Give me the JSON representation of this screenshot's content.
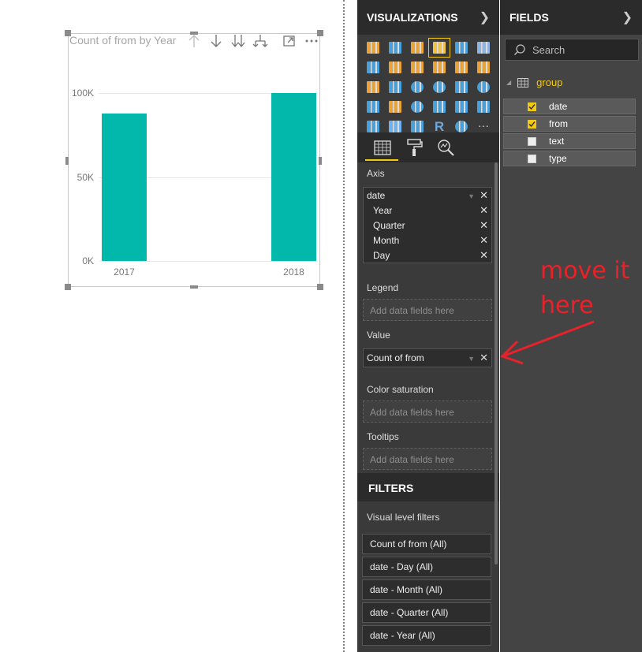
{
  "visual": {
    "title": "Count of from by Year",
    "icons": [
      "drill-up-icon",
      "drill-down-icon",
      "expand-all-icon",
      "expand-next-icon",
      "focus-mode-icon",
      "more-options-icon"
    ]
  },
  "chart_data": {
    "type": "bar",
    "title": "Count of from by Year",
    "categories": [
      "2017",
      "2018"
    ],
    "values": [
      88000,
      101000
    ],
    "yticks": [
      "100K",
      "50K",
      "0K"
    ],
    "ylim": [
      0,
      100000
    ],
    "xlabel": "",
    "ylabel": "",
    "grid": true,
    "color": "#01b8aa"
  },
  "visualizations": {
    "header": "VISUALIZATIONS",
    "tabs": [
      "fields-tab",
      "format-tab",
      "analytics-tab"
    ],
    "wells": {
      "axis": {
        "title": "Axis",
        "field": "date",
        "hierarchy": [
          "Year",
          "Quarter",
          "Month",
          "Day"
        ]
      },
      "legend": {
        "title": "Legend",
        "placeholder": "Add data fields here"
      },
      "value": {
        "title": "Value",
        "field": "Count of from"
      },
      "color_saturation": {
        "title": "Color saturation",
        "placeholder": "Add data fields here"
      },
      "tooltips": {
        "title": "Tooltips",
        "placeholder": "Add data fields here"
      }
    }
  },
  "filters": {
    "header": "FILTERS",
    "section": "Visual level filters",
    "items": [
      "Count of from  (All)",
      "date - Day  (All)",
      "date - Month  (All)",
      "date - Quarter  (All)",
      "date - Year  (All)"
    ]
  },
  "fields": {
    "header": "FIELDS",
    "search_placeholder": "Search",
    "group": "group",
    "items": [
      {
        "label": "date",
        "checked": true
      },
      {
        "label": "from",
        "checked": true
      },
      {
        "label": "text",
        "checked": false
      },
      {
        "label": "type",
        "checked": false
      }
    ]
  },
  "annotation": {
    "line1": "move it",
    "line2": "here",
    "color": "#e8222a"
  },
  "colors": {
    "accent": "#f2c811",
    "bar": "#01b8aa",
    "pane_bg": "#3a3a3a",
    "pane_header": "#2b2b2b"
  }
}
